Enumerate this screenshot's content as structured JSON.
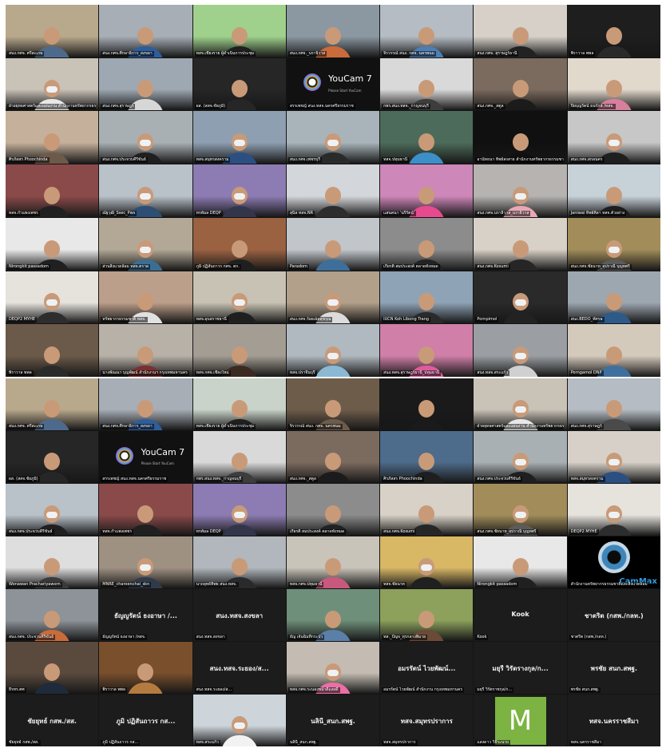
{
  "top_grid": [
    {
      "name": "สนง.กศจ. ศรีสะเกษ",
      "kind": "video",
      "bg": "#b9a98c",
      "shirt": "#4d6a8c",
      "mask": false
    },
    {
      "name": "สนง.กศจ.ศึกษาธิการ_สงขลา",
      "kind": "video",
      "bg": "#a7aeb6",
      "shirt": "#2e5d9b",
      "mask": false
    },
    {
      "name": "ทสจ.เชียงราย ผู้ดำเนินการประชุม",
      "kind": "video",
      "bg": "#9fd18c",
      "shirt": "#1f1f1f",
      "mask": false
    },
    {
      "name": "สนง.กศจ._นราธิวาส",
      "kind": "video",
      "bg": "#8b98a2",
      "shirt": "#c96b3a",
      "mask": false
    },
    {
      "name": "จิรวรรณ์ สนง. กศจ. นครพนม",
      "kind": "video",
      "bg": "#b5bcc3",
      "shirt": "#4b7fb5",
      "mask": false
    },
    {
      "name": "สนง.กศจ. สุราษฎร์ธานี",
      "kind": "video",
      "bg": "#d6d0c8",
      "shirt": "#222222",
      "mask": false
    },
    {
      "name": "พิราวาล พพล",
      "kind": "video",
      "bg": "#1e1e1e",
      "shirt": "#2a2a2a",
      "mask": false
    },
    {
      "name": "ฝ่ายยุทธศาสตร์และแผนงาน สำนักงานทรัพยากรธรรมชาติ",
      "kind": "video",
      "bg": "#c9c2b7",
      "shirt": "#e8e8e8",
      "mask": true
    },
    {
      "name": "สนง.กศจ.สุราษฎร์",
      "kind": "video",
      "bg": "#9ea8b2",
      "shirt": "#d7d7d7",
      "mask": false
    },
    {
      "name": "ผส. (สสจ.ชัยภูมิ)",
      "kind": "video",
      "bg": "#262626",
      "shirt": "#262626",
      "mask": false
    },
    {
      "name": "สรรเพชญ์ สนง.ทสจ.นครศรีธรรมราช",
      "kind": "youcam",
      "bg": "#111111",
      "shirt": "#111111",
      "mask": false
    },
    {
      "name": "กพร.สนง.ทสจ._กาญจนบุรี",
      "kind": "video",
      "bg": "#d9d9d9",
      "shirt": "#3d3d3d",
      "mask": false
    },
    {
      "name": "สนง.กศจ._สตูล",
      "kind": "video",
      "bg": "#7b6a5e",
      "shirt": "#1b1b1b",
      "mask": false
    },
    {
      "name": "ปิยบุญรัตน์ ธนรักษ์ /ทสจ.",
      "kind": "video",
      "bg": "#e1d9cc",
      "shirt": "#d77f9c",
      "mask": false
    },
    {
      "name": "ศิรภัสสร Phoochinda",
      "kind": "video",
      "bg": "#c5b09b",
      "shirt": "#6e5a4a",
      "mask": false
    },
    {
      "name": "สนง.กศจ.ประจวบคีรีขันธ์",
      "kind": "video",
      "bg": "#a9b0b3",
      "shirt": "#1f1f1f",
      "mask": true
    },
    {
      "name": "ทสจ.สมุทรสงคราม",
      "kind": "video",
      "bg": "#8e9fb1",
      "shirt": "#2c4f82",
      "mask": true
    },
    {
      "name": "สนง.กศจ.เพชรบุรี",
      "kind": "video",
      "bg": "#a8b4ba",
      "shirt": "#2a2a2a",
      "mask": true
    },
    {
      "name": "ทสจ.ปทุมธานี",
      "kind": "video",
      "bg": "#4d6b5a",
      "shirt": "#3c8fc7",
      "mask": false
    },
    {
      "name": "อานัทธนา ทิพย์สงสาย สำนักงานทรัพยากรธรรมชาติ",
      "kind": "video",
      "bg": "#101010",
      "shirt": "#101010",
      "mask": false
    },
    {
      "name": "สนง.กศจ.สกลนคร",
      "kind": "video",
      "bg": "#c7c7c7",
      "shirt": "#1f1f1f",
      "mask": true
    },
    {
      "name": "ทสจ.กำแพงเพชร",
      "kind": "video",
      "bg": "#8b4a4a",
      "shirt": "#202020",
      "mask": false
    },
    {
      "name": "ณัฐวุฒิ_Ssec_Pws",
      "kind": "video",
      "bg": "#b9c1c9",
      "shirt": "#2e4e73",
      "mask": true
    },
    {
      "name": "ทรพ์มล DEQP",
      "kind": "video",
      "bg": "#8d7cb3",
      "shirt": "#33364a",
      "mask": true
    },
    {
      "name": "สุนิล ทสจ.NR",
      "kind": "video",
      "bg": "#d3d6da",
      "shirt": "#2d2d2d",
      "mask": false
    },
    {
      "name": "แสนคนา 'นรีรัตน์'",
      "kind": "video",
      "bg": "#ce87b9",
      "shirt": "#e74a8f",
      "mask": false
    },
    {
      "name": "สนง.กศจ.นราธิวาส_นราธิวาส",
      "kind": "video",
      "bg": "#b6b3b1",
      "shirt": "#e9a7b5",
      "mask": true
    },
    {
      "name": "Janiwai ทิพย์ศิลา ทสจ.ตัวอย่าง",
      "kind": "video",
      "bg": "#c7d1d8",
      "shirt": "#1d1d1d",
      "mask": false
    },
    {
      "name": "Nirongkit passadom",
      "kind": "video",
      "bg": "#e8e8e8",
      "shirt": "#202020",
      "mask": false
    },
    {
      "name": "ส่วนสิ่งแวดล้อม ทสจ.ตราด",
      "kind": "video",
      "bg": "#b3a896",
      "shirt": "#3a6e96",
      "mask": true
    },
    {
      "name": "ภูมิ ปฏิสันถาวร กศจ. ตก.",
      "kind": "video",
      "bg": "#9b6242",
      "shirt": "#1f1f1f",
      "mask": false
    },
    {
      "name": "Paradorn",
      "kind": "video",
      "bg": "#c1c6cb",
      "shirt": "#3e6e9a",
      "mask": false
    },
    {
      "name": "เกียรติ สมประสงค์ ตลาดทั้งหมด",
      "kind": "video",
      "bg": "#8c8c8c",
      "shirt": "#222222",
      "mask": false
    },
    {
      "name": "สนง.กศจ.Kosumi",
      "kind": "video",
      "bg": "#d8d1c7",
      "shirt": "#262626",
      "mask": false
    },
    {
      "name": "สนง.กศจ.ชัยนาท_สุปราณี บุญทศรี",
      "kind": "video",
      "bg": "#a28d5a",
      "shirt": "#5b5b5b",
      "mask": true
    },
    {
      "name": "DEQP2 MYHE",
      "kind": "video",
      "bg": "#e6e2dc",
      "shirt": "#2d2d2d",
      "mask": true
    },
    {
      "name": "ทรัพยากรธรรมชาติ ทสจ.",
      "kind": "video",
      "bg": "#bc9f8a",
      "shirt": "#e1e1e1",
      "mask": false
    },
    {
      "name": "ทสจ.อุบลราชธานี",
      "kind": "video",
      "bg": "#c7c2b3",
      "shirt": "#1f1f1f",
      "mask": true
    },
    {
      "name": "สนง.กศจ.ร้อยเอ็ดสุขรุณ",
      "kind": "video",
      "bg": "#b2a08a",
      "shirt": "#dcdcdc",
      "mask": true
    },
    {
      "name": "IUCN Koh Libong Trang",
      "kind": "video",
      "bg": "#8ea3b6",
      "shirt": "#2a2a2a",
      "mask": false
    },
    {
      "name": "Pornpimol",
      "kind": "video",
      "bg": "#2a2a2a",
      "shirt": "#222222",
      "mask": true
    },
    {
      "name": "สนง.BEDO_ทัศรษ",
      "kind": "video",
      "bg": "#9da7b0",
      "shirt": "#2e5a8a",
      "mask": false
    },
    {
      "name": "พิราวาล พพล",
      "kind": "video",
      "bg": "#6b5a4a",
      "shirt": "#2a2a2a",
      "mask": false
    },
    {
      "name": "นางพัณณา บุญพัฒน์ สำนักงานฯ กรุงเทพมหานคร",
      "kind": "video",
      "bg": "#b8b1a8",
      "shirt": "#7b2f2f",
      "mask": false
    },
    {
      "name": "ทสจ.กศจ.เชียงใหม่",
      "kind": "video",
      "bg": "#a39d93",
      "shirt": "#3b2a1f",
      "mask": false
    },
    {
      "name": "ทสจ.ปราจีนบุรี",
      "kind": "video",
      "bg": "#b0b9bf",
      "shirt": "#8bb9d4",
      "mask": true
    },
    {
      "name": "สนง.ทสจ.สุราษฎร์ธานี_ปทุมธานี",
      "kind": "video",
      "bg": "#cf7fa8",
      "shirt": "#e05a9e",
      "mask": false
    },
    {
      "name": "สนง.ทสจ.สระแก้ว",
      "kind": "video",
      "bg": "#9b9fa3",
      "shirt": "#d0d0d0",
      "mask": true
    },
    {
      "name": "Porngamol DNP",
      "kind": "video",
      "bg": "#d4cabc",
      "shirt": "#3f6f9e",
      "mask": false
    }
  ],
  "bottom_grid": [
    {
      "name": "สนง.กศจ. ศรีสะเกษ",
      "kind": "video",
      "bg": "#b9a98c",
      "shirt": "#4d6a8c",
      "mask": false
    },
    {
      "name": "สนง.กศจ.ศึกษาธิการ_สงขลา",
      "kind": "video",
      "bg": "#a7aeb6",
      "shirt": "#2e5d9b",
      "mask": false
    },
    {
      "name": "ทสจ.เชียงราย ผู้ดำเนินการประชุม",
      "kind": "video",
      "bg": "#c9d3c9",
      "shirt": "#1f1f1f",
      "mask": false
    },
    {
      "name": "จิรวรรณ์ สนง. กศจ. นครพนม",
      "kind": "video",
      "bg": "#6e5c4a",
      "shirt": "#6e5c4a",
      "mask": false
    },
    {
      "name": "",
      "kind": "video",
      "bg": "#1a1a1a",
      "shirt": "#1a1a1a",
      "mask": false
    },
    {
      "name": "ฝ่ายยุทธศาสตร์และแผนงาน สำนักงานทรัพยากรธรรมชาติ",
      "kind": "video",
      "bg": "#c9c2b7",
      "shirt": "#e8e8e8",
      "mask": true
    },
    {
      "name": "สนง.กศจ.สุราษฎร์",
      "kind": "video",
      "bg": "#b5bcc3",
      "shirt": "#4a4a4a",
      "mask": false
    },
    {
      "name": "ผส. (สสจ.ชัยภูมิ)",
      "kind": "video",
      "bg": "#262626",
      "shirt": "#262626",
      "mask": false
    },
    {
      "name": "สรรเพชญ์ สนง.ทสจ.นครศรีธรรมราช",
      "kind": "youcam",
      "bg": "#111111",
      "shirt": "#111111",
      "mask": false
    },
    {
      "name": "กพร.สนง.ทสจ._กาญจนบุรี",
      "kind": "video",
      "bg": "#d9d9d9",
      "shirt": "#3d3d3d",
      "mask": false
    },
    {
      "name": "สนง.กศจ._สตูล",
      "kind": "video",
      "bg": "#7b6a5e",
      "shirt": "#1b1b1b",
      "mask": false
    },
    {
      "name": "ศิรภัสสร Phoochinda",
      "kind": "video",
      "bg": "#4d6b8a",
      "shirt": "#1f1f1f",
      "mask": false
    },
    {
      "name": "สนง.กศจ.ประจวบคีรีขันธ์",
      "kind": "video",
      "bg": "#a9b0b3",
      "shirt": "#1f1f1f",
      "mask": true
    },
    {
      "name": "ทสจ.สมุทรสงคราม",
      "kind": "video",
      "bg": "#d6d0c8",
      "shirt": "#2c4f82",
      "mask": true
    },
    {
      "name": "สนง.กศจ.ประจวบคีรีขันธ์",
      "kind": "video",
      "bg": "#b9c1c9",
      "shirt": "#1f1f1f",
      "mask": true
    },
    {
      "name": "ทสจ.กำแพงเพชร",
      "kind": "video",
      "bg": "#8b4a4a",
      "shirt": "#202020",
      "mask": false
    },
    {
      "name": "ทรพ์มล DEQP",
      "kind": "video",
      "bg": "#8d7cb3",
      "shirt": "#33364a",
      "mask": true
    },
    {
      "name": "เกียรติ สมประสงค์ ตลาดทั้งหมด",
      "kind": "video",
      "bg": "#8c8c8c",
      "shirt": "#222222",
      "mask": false
    },
    {
      "name": "สนง.กศจ.Kosumi",
      "kind": "video",
      "bg": "#d8d1c7",
      "shirt": "#262626",
      "mask": false
    },
    {
      "name": "สนง.กศจ.ชัยนาท_สุปราณี บุญทศรี",
      "kind": "video",
      "bg": "#a28d5a",
      "shirt": "#5b5b5b",
      "mask": true
    },
    {
      "name": "DEQP2 MYHE",
      "kind": "video",
      "bg": "#e6e2dc",
      "shirt": "#2d2d2d",
      "mask": true
    },
    {
      "name": "Wonawan Prachariyaworn",
      "kind": "video",
      "bg": "#dedede",
      "shirt": "#3a3a3a",
      "mask": false
    },
    {
      "name": "MNRE_charoenchai_skn",
      "kind": "video",
      "bg": "#9f9182",
      "shirt": "#2f3b4b",
      "mask": true
    },
    {
      "name": "นาถยุทธ์ทิพย สนง.ทสจ.",
      "kind": "video",
      "bg": "#b1b7bc",
      "shirt": "#2a2a2a",
      "mask": false
    },
    {
      "name": "ทสจ.กศจ.ปทุมธานี",
      "kind": "video",
      "bg": "#c9c4ba",
      "shirt": "#c9587f",
      "mask": false
    },
    {
      "name": "ทสจ.ชัยนาท",
      "kind": "video",
      "bg": "#d8b765",
      "shirt": "#202020",
      "mask": true
    },
    {
      "name": "Nirongkit passadom",
      "kind": "video",
      "bg": "#e8e8e8",
      "shirt": "#202020",
      "mask": false
    },
    {
      "name": "สำนักงานทรัพยากรธรรมชาติและสิ่งแวดล้อม",
      "kind": "webcam",
      "bg": "#000000",
      "shirt": "#000000",
      "mask": false
    },
    {
      "name": "สนง.กศจ. ประจวบคีรีขันธ์",
      "kind": "video",
      "bg": "#8d9399",
      "shirt": "#c96b3a",
      "mask": false
    },
    {
      "name": "ธัญญรัตน์ ธงอาษา /ทสจ.",
      "kind": "dark",
      "big": "ธัญญรัตน์ ธงอาษา /...",
      "bg": "#1c1c1c",
      "shirt": "#1c1c1c",
      "mask": false
    },
    {
      "name": "สนง.ทสจ.สงขลา",
      "kind": "dark",
      "big": "สนง.ทสจ.สงขลา",
      "bg": "#1c1c1c",
      "shirt": "#1c1c1c",
      "mask": false
    },
    {
      "name": "ธัญ เจ้นฉิมที่กระบัว",
      "kind": "video",
      "bg": "#6e8f7a",
      "shirt": "#5a7fa8",
      "mask": false
    },
    {
      "name": "ทส._ปัญจ_ทุรกลางพิมาย",
      "kind": "video",
      "bg": "#8da15c",
      "shirt": "#6b4a36",
      "mask": false
    },
    {
      "name": "Kook",
      "kind": "dark",
      "big": "Kook",
      "bg": "#1c1c1c",
      "shirt": "#1c1c1c",
      "mask": false
    },
    {
      "name": "ชาตรีต (กสพ./กลท.)",
      "kind": "dark",
      "big": "ชาตริต (กสพ./กลท.)",
      "bg": "#1c1c1c",
      "shirt": "#1c1c1c",
      "mask": false
    },
    {
      "name": "ธีรทร.ศศ",
      "kind": "video",
      "bg": "#5a4a3e",
      "shirt": "#1f2a3a",
      "mask": false
    },
    {
      "name": "พิราวาล พพล",
      "kind": "video",
      "bg": "#7a4f2c",
      "shirt": "#b57a3f",
      "mask": false
    },
    {
      "name": "สนง.ทสจ.ระยอง/ส...",
      "kind": "dark",
      "big": "สนง.ทสจ.ระยอง/ส...",
      "bg": "#1c1c1c",
      "shirt": "#1c1c1c",
      "mask": false
    },
    {
      "name": "ทสจ.กศจ.ระนองชน้ำดีแสงดี",
      "kind": "video",
      "bg": "#c4bcb2",
      "shirt": "#ea6fa5",
      "mask": true
    },
    {
      "name": "อมรรัตน์ ไวยพัฒน์ สำนักงาน กรุงเทพมหานคร",
      "kind": "dark",
      "big": "อมรรัตน์ ไวยพัฒน์...",
      "bg": "#1c1c1c",
      "shirt": "#1c1c1c",
      "mask": false
    },
    {
      "name": "มยุรี วิรัตราชกุล/ก...",
      "kind": "dark",
      "big": "มยุรี วิรัตรางกุล/ก...",
      "bg": "#1c1c1c",
      "shirt": "#1c1c1c",
      "mask": false
    },
    {
      "name": "พรชัย สนก.สพฐ.",
      "kind": "dark",
      "big": "พรชัย สนก.สพฐ.",
      "bg": "#1c1c1c",
      "shirt": "#1c1c1c",
      "mask": false
    },
    {
      "name": "ชัยยุทธ์ กสพ./สส.",
      "kind": "dark",
      "big": "ชัยยุทธ์ กสพ./สส.",
      "bg": "#1c1c1c",
      "shirt": "#1c1c1c",
      "mask": false
    },
    {
      "name": "ภูมิ ปฏิสันถาวร กส...",
      "kind": "dark",
      "big": "ภูมิ ปฏิสันถาวร กส...",
      "bg": "#1c1c1c",
      "shirt": "#1c1c1c",
      "mask": false
    },
    {
      "name": "ทสจ.สระแก้ว",
      "kind": "video",
      "bg": "#cdd5db",
      "shirt": "#f2f2f2",
      "mask": true
    },
    {
      "name": "นลินี_สนก.สพฐ.",
      "kind": "dark",
      "big": "นลินี_สนก.สพฐ.",
      "bg": "#1c1c1c",
      "shirt": "#1c1c1c",
      "mask": false
    },
    {
      "name": "ทสจ.สมุทรปราการ",
      "kind": "dark",
      "big": "ทสจ.สมุทรปราการ",
      "bg": "#1c1c1c",
      "shirt": "#1c1c1c",
      "mask": false
    },
    {
      "name": "แสงดาว วิธีระนาถ",
      "kind": "avatar",
      "letter": "M",
      "bg": "#1c1c1c",
      "shirt": "#1c1c1c",
      "mask": false
    },
    {
      "name": "ทสจ.นครราชสีมา",
      "kind": "dark",
      "big": "ทสจ.นครราชสีมา",
      "bg": "#1c1c1c",
      "shirt": "#1c1c1c",
      "mask": false
    }
  ],
  "youcam": {
    "title": "YouCam 7",
    "subtitle": "Please Start YouCam"
  },
  "webcam_mark": "CamMax"
}
